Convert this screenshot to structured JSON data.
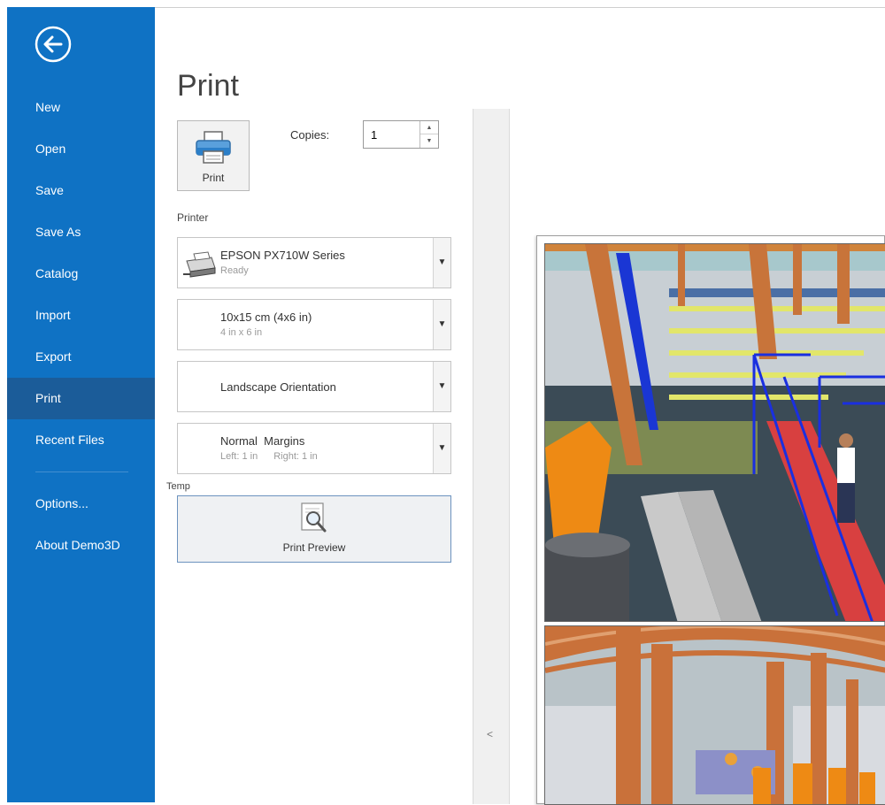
{
  "sidebar": {
    "back_icon": "back-arrow-circle-icon",
    "items": [
      {
        "label": "New"
      },
      {
        "label": "Open"
      },
      {
        "label": "Save"
      },
      {
        "label": "Save As"
      },
      {
        "label": "Catalog"
      },
      {
        "label": "Import"
      },
      {
        "label": "Export"
      },
      {
        "label": "Print",
        "active": true
      },
      {
        "label": "Recent Files"
      }
    ],
    "footer_items": [
      {
        "label": "Options..."
      },
      {
        "label": "About Demo3D"
      }
    ],
    "colors": {
      "background": "#0f72c4",
      "active": "#1b5c99"
    }
  },
  "main": {
    "title": "Print",
    "print_button": {
      "label": "Print",
      "icon": "printer-icon"
    },
    "copies": {
      "label": "Copies:",
      "value": "1"
    },
    "printer_label": "Printer",
    "printer": {
      "name": "EPSON PX710W Series",
      "status": "Ready",
      "icon": "printer-device-icon"
    },
    "paper": {
      "name": "10x15 cm (4x6 in)",
      "size": "4 in x 6 in"
    },
    "orientation": {
      "name": "Landscape Orientation"
    },
    "margins": {
      "name": "Normal  Margins",
      "left": "Left: 1 in",
      "right": "Right: 1 in"
    },
    "temp_label": "Temp",
    "preview_button": {
      "label": "Print Preview",
      "icon": "magnifier-page-icon"
    }
  },
  "splitter": {
    "arrow": "<"
  },
  "preview": {
    "images": [
      {
        "name": "warehouse-mezzanine-render",
        "description_icon": "3d-render-image"
      },
      {
        "name": "warehouse-aisle-render",
        "description_icon": "3d-render-image"
      }
    ]
  }
}
